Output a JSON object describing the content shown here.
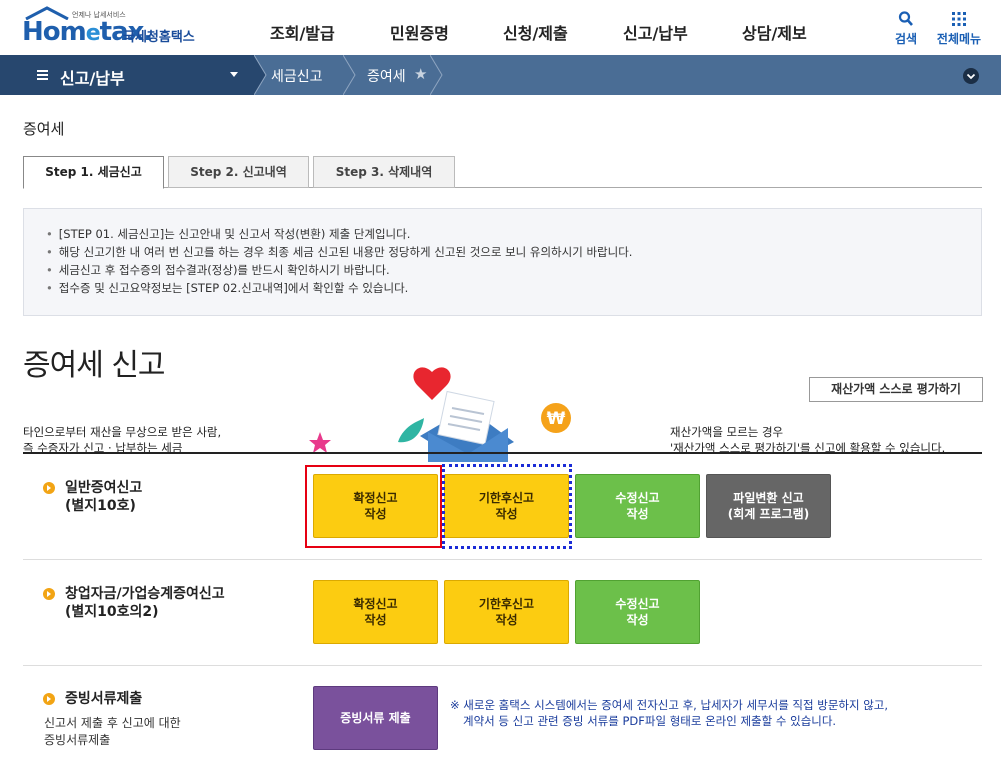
{
  "header": {
    "logo_small": "언제나 납세서비스",
    "logo_home_prefix": "Hom",
    "logo_home_e": "e",
    "logo_home_suffix": "tax.",
    "logo_nts": "국세청홈택스",
    "menu": [
      "조회/발급",
      "민원증명",
      "신청/제출",
      "신고/납부",
      "상담/제보"
    ],
    "search_label": "검색",
    "allmenu_label": "전체메뉴"
  },
  "nav": {
    "current_menu": "신고/납부",
    "crumb1": "세금신고",
    "crumb2": "증여세"
  },
  "page": {
    "title": "증여세",
    "tabs": [
      "Step 1. 세금신고",
      "Step 2. 신고내역",
      "Step 3. 삭제내역"
    ],
    "info": [
      "[STEP 01. 세금신고]는 신고안내 및 신고서 작성(변환) 제출 단계입니다.",
      "해당 신고기한 내 여러 번 신고를 하는 경우 최종 세금 신고된 내용만 정당하게 신고된 것으로 보니 유의하시기 바랍니다.",
      "세금신고 후 접수증의 접수결과(정상)를 반드시 확인하시기 바랍니다.",
      "접수증 및 신고요약정보는 [STEP 02.신고내역]에서 확인할 수 있습니다."
    ],
    "big_title": "증여세 신고",
    "self_eval_button": "재산가액 스스로 평가하기",
    "desc_left_1": "타인으로부터 재산을 무상으로 받은 사람,",
    "desc_left_2": "즉 수증자가 신고 · 납부하는 세금",
    "desc_right_1": "재산가액을 모르는 경우",
    "desc_right_2": "'재산가액 스스로 평가하기'를 신고에 활용할 수 있습니다."
  },
  "rows": [
    {
      "title_1": "일반증여신고",
      "title_2": "(별지10호)",
      "buttons": [
        "확정신고\n작성",
        "기한후신고\n작성",
        "수정신고\n작성",
        "파일변환 신고\n(회계 프로그램)"
      ]
    },
    {
      "title_1": "창업자금/가업승계증여신고",
      "title_2": "(별지10호의2)",
      "buttons": [
        "확정신고\n작성",
        "기한후신고\n작성",
        "수정신고\n작성"
      ]
    },
    {
      "title_1": "증빙서류제출",
      "sub_1": "신고서 제출 후 신고에 대한",
      "sub_2": "증빙서류제출",
      "buttons": [
        "증빙서류 제출"
      ],
      "note_1": "※ 새로운 홈택스 시스템에서는 증여세 전자신고 후, 납세자가 세무서를 직접 방문하지 않고,",
      "note_2": "계약서 등 신고 관련 증빙 서류를 PDF파일 형태로 온라인 제출할 수 있습니다."
    }
  ],
  "colors": {
    "nav_dark": "#27476e",
    "nav_light": "#4a6d95",
    "yellow_button": "#fccc11",
    "green_button": "#6cc04a",
    "gray_button": "#666666",
    "purple_button": "#7a519c",
    "highlight_red": "#e60012",
    "highlight_blue": "#1a2bd6"
  }
}
